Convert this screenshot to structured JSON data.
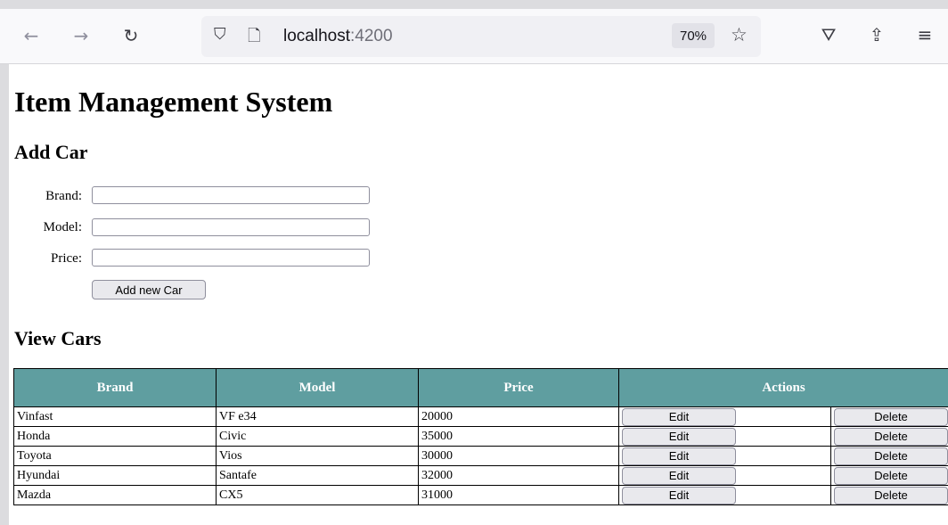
{
  "browser": {
    "url_host": "localhost",
    "url_port": ":4200",
    "zoom": "70%"
  },
  "page": {
    "title": "Item Management System",
    "add_section_title": "Add Car",
    "view_section_title": "View Cars",
    "form": {
      "brand_label": "Brand:",
      "model_label": "Model:",
      "price_label": "Price:",
      "brand_value": "",
      "model_value": "",
      "price_value": "",
      "submit_label": "Add new Car"
    },
    "table": {
      "headers": [
        "Brand",
        "Model",
        "Price",
        "Actions"
      ],
      "edit_label": "Edit",
      "delete_label": "Delete",
      "rows": [
        {
          "brand": "Vinfast",
          "model": "VF e34",
          "price": "20000"
        },
        {
          "brand": "Honda",
          "model": "Civic",
          "price": "35000"
        },
        {
          "brand": "Toyota",
          "model": "Vios",
          "price": "30000"
        },
        {
          "brand": "Hyundai",
          "model": "Santafe",
          "price": "32000"
        },
        {
          "brand": "Mazda",
          "model": "CX5",
          "price": "31000"
        }
      ]
    }
  },
  "colors": {
    "header_bg": "#5f9ea0",
    "header_text": "#ffffff"
  }
}
